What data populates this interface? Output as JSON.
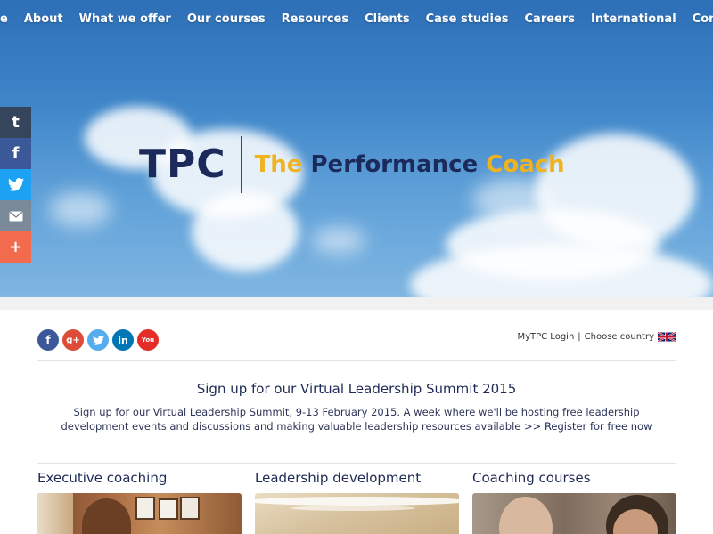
{
  "nav": {
    "items": [
      "Home",
      "About",
      "What we offer",
      "Our courses",
      "Resources",
      "Clients",
      "Case studies",
      "Careers",
      "International",
      "Contact"
    ]
  },
  "hero": {
    "logo_mark": "TPC",
    "logo_word_1": "The ",
    "logo_word_2": "Performance ",
    "logo_word_3": "Coach"
  },
  "side_share": {
    "buttons": [
      {
        "icon": "tumblr-icon",
        "label": "t",
        "color": "#35465c"
      },
      {
        "icon": "facebook-icon",
        "label": "f",
        "color": "#3b5998"
      },
      {
        "icon": "twitter-icon",
        "label": "✦",
        "color": "#1da1f2"
      },
      {
        "icon": "email-icon",
        "label": "✉",
        "color": "#7a8a99"
      },
      {
        "icon": "more-icon",
        "label": "+",
        "color": "#f26b4f"
      }
    ]
  },
  "social_row": [
    {
      "icon": "facebook-icon",
      "label": "f",
      "color": "#3b5998"
    },
    {
      "icon": "googleplus-icon",
      "label": "g+",
      "color": "#dd4b39"
    },
    {
      "icon": "twitter-icon",
      "label": "t",
      "color": "#55acee"
    },
    {
      "icon": "linkedin-icon",
      "label": "in",
      "color": "#0077b5"
    },
    {
      "icon": "youtube-icon",
      "label": "You",
      "color": "#e52d27"
    }
  ],
  "account": {
    "login": "MyTPC Login",
    "separator": "|",
    "country": "Choose country"
  },
  "promo": {
    "title": "Sign up for our Virtual Leadership Summit 2015",
    "body_text": "Sign up for our Virtual Leadership Summit, 9-13 February 2015. A week where we'll be hosting free leadership development events and discussions and making valuable leadership resources available ",
    "link": ">> Register for free now"
  },
  "cards": [
    {
      "title": "Executive coaching"
    },
    {
      "title": "Leadership development"
    },
    {
      "title": "Coaching courses"
    }
  ]
}
